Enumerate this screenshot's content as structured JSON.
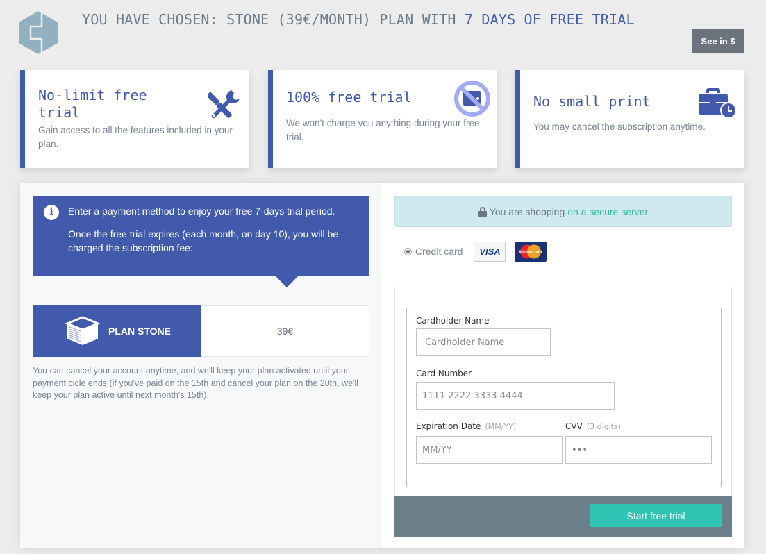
{
  "header": {
    "logo_icon": "hexagon-logo-icon",
    "headline_prefix": "YOU HAVE CHOSEN: STONE (39€/MONTH) PLAN WITH ",
    "headline_accent": "7 DAYS OF FREE TRIAL",
    "currency_button": "See in $"
  },
  "features": [
    {
      "title": "No-limit free trial",
      "title_line1": "No-limit free",
      "title_line2": "trial",
      "description": "Gain access to all the features included in your plan.",
      "icon": "tools-icon"
    },
    {
      "title": "100% free trial",
      "description": "We won't charge you anything during your free trial.",
      "icon": "no-wallet-icon"
    },
    {
      "title": "No small print",
      "description": "You may cancel the subscription anytime.",
      "icon": "briefcase-clock-icon"
    }
  ],
  "info": {
    "line1": "Enter a payment method to enjoy your free 7-days trial period.",
    "line2": "Once the free trial expires (each month, on day 10), you will be charged the subscription fee:",
    "icon": "info-icon"
  },
  "plan": {
    "name": "PLAN STONE",
    "price": "39€",
    "icon": "cube-icon"
  },
  "cancel_note": "You can cancel your account anytime, and we'll keep your plan activated until your payment cicle ends (if you've paid on the 15th and cancel your plan on the 20th, we'll keep your plan active until next month's 15th).",
  "secure": {
    "text": "You are shopping",
    "link": "on a secure server",
    "icon": "lock-icon"
  },
  "payment": {
    "method_label": "Credit card",
    "method_selected": true,
    "cards": [
      "VISA",
      "MasterCard"
    ]
  },
  "form": {
    "cardholder_label": "Cardholder Name",
    "cardholder_placeholder": "Cardholder Name",
    "cardholder_value": "",
    "card_number_label": "Card Number",
    "card_number_placeholder": "1111 2222 3333 4444",
    "card_number_value": "",
    "expiration_label": "Expiration Date",
    "expiration_hint": "(MM/YY)",
    "expiration_placeholder": "MM/YY",
    "cvv_label": "CVV",
    "cvv_hint": "(3 digits)",
    "cvv_placeholder": "•••",
    "submit_label": "Start free trial"
  },
  "colors": {
    "primary": "#425aab",
    "accent_teal": "#2ec4b3",
    "footer_gray": "#6b808a",
    "secure_bg": "#cfe9ee"
  }
}
